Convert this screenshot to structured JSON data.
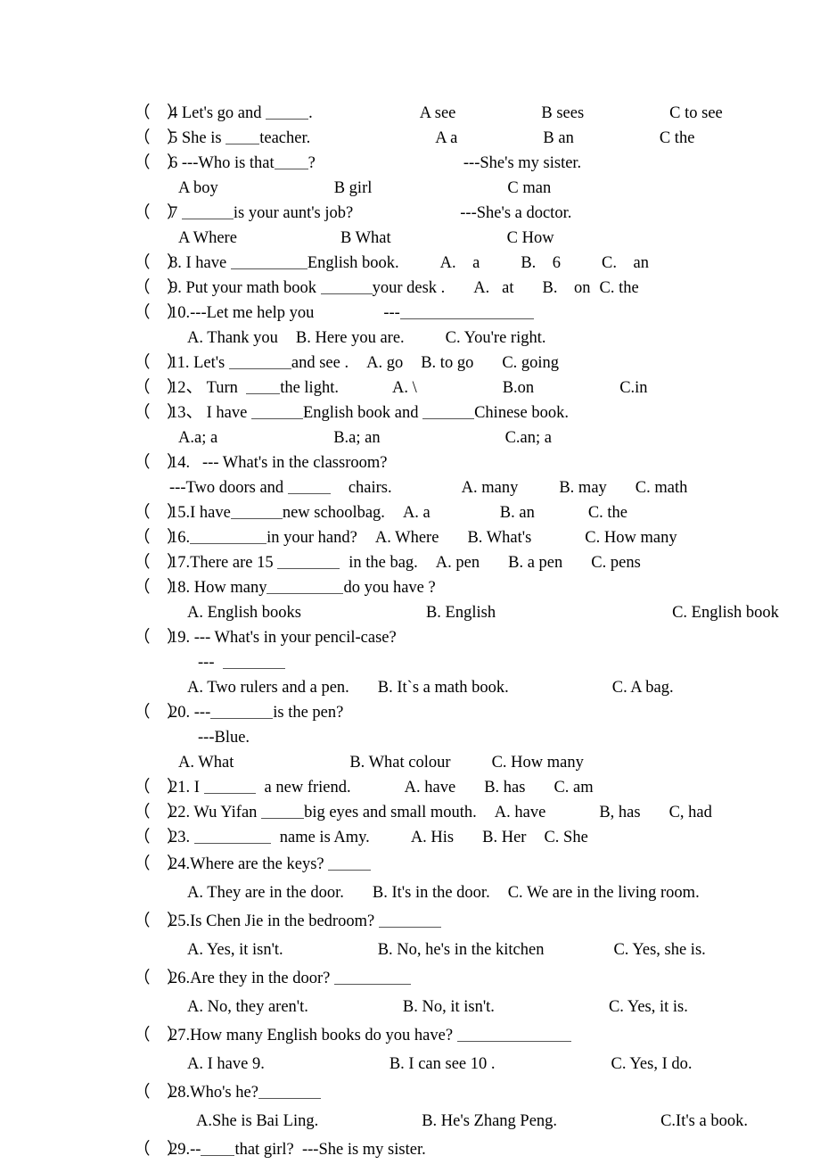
{
  "document": {
    "type": "worksheet",
    "subject": "English multiple-choice exercise",
    "marker": "（    ）"
  },
  "questions": [
    {
      "id": "q4",
      "number": "4",
      "stem_before": "4 Let's go and ",
      "stem_after": ".",
      "options_inline": [
        "A see",
        "B sees",
        "C to see"
      ]
    },
    {
      "id": "q5",
      "number": "5",
      "stem_before": "5 She is ",
      "stem_after": "teacher.",
      "options_inline": [
        "A a",
        "B an",
        "C the"
      ]
    },
    {
      "id": "q6",
      "number": "6",
      "stem_before": "6 ---Who is that",
      "stem_after": "?",
      "answer_hint": "---She's my sister.",
      "options_line": [
        "A boy",
        "B girl",
        "C man"
      ]
    },
    {
      "id": "q7",
      "number": "7",
      "stem_before": "7 ",
      "stem_after": "is your aunt's job?",
      "answer_hint": "---She's a doctor.",
      "options_line": [
        "A Where",
        "B What",
        "C How"
      ]
    },
    {
      "id": "q8",
      "number": "8",
      "stem_before": "8. I have ",
      "stem_after": "English book.",
      "options_inline": [
        "A.    a",
        "B.    6",
        "C.    an"
      ]
    },
    {
      "id": "q9",
      "number": "9",
      "stem_before": "9. Put your math book ",
      "stem_after": "your desk .",
      "options_inline": [
        "A.   at",
        "B.    on",
        "C. the"
      ]
    },
    {
      "id": "q10",
      "number": "10",
      "stem_before": "10.---Let me help you",
      "stem_after": "---",
      "options_line": [
        "A. Thank you",
        "B. Here you are.",
        "C. You're right."
      ]
    },
    {
      "id": "q11",
      "number": "11",
      "stem_before": "11. Let's ",
      "stem_after": "and see .",
      "options_inline": [
        "A. go",
        "B. to go",
        "C. going"
      ]
    },
    {
      "id": "q12",
      "number": "12",
      "stem_before": "12、 Turn  ",
      "stem_after": "the light.",
      "options_inline": [
        "A. \\",
        "B.on",
        "C.in"
      ]
    },
    {
      "id": "q13",
      "number": "13",
      "stem_before": "13、 I have ",
      "stem_mid": "English book and ",
      "stem_after": "Chinese book.",
      "options_line": [
        "A.a; a",
        "B.a; an",
        "C.an; a"
      ]
    },
    {
      "id": "q14",
      "number": "14",
      "stem_before": "14.   --- What's in the classroom?",
      "stem_second_before": "---Two doors and ",
      "stem_second_after": "chairs.",
      "options_inline": [
        "A. many",
        "B. may",
        "C. math"
      ]
    },
    {
      "id": "q15",
      "number": "15",
      "stem_before": "15.I have",
      "stem_after": "new schoolbag.",
      "options_inline": [
        "A. a",
        "B. an",
        "C. the"
      ]
    },
    {
      "id": "q16",
      "number": "16",
      "stem_before": "16.",
      "stem_after": "in your hand?",
      "options_inline": [
        "A. Where",
        "B. What's",
        "C. How many"
      ]
    },
    {
      "id": "q17",
      "number": "17",
      "stem_before": "17.There are 15 ",
      "stem_after": "in the bag.",
      "options_inline": [
        "A. pen",
        "B. a pen",
        "C. pens"
      ]
    },
    {
      "id": "q18",
      "number": "18",
      "stem_before": "18. How many",
      "stem_after": "do you have ?",
      "options_line": [
        "A. English books",
        "B. English",
        "C. English book"
      ]
    },
    {
      "id": "q19",
      "number": "19",
      "stem_before": "19. --- What's in your pencil-case?",
      "stem_second": "---",
      "options_line": [
        "A. Two rulers and a pen.",
        "B. It`s a math book.",
        "C. A bag."
      ]
    },
    {
      "id": "q20",
      "number": "20",
      "stem_before": "20. ---",
      "stem_after": "is the pen?",
      "answer_hint": "---Blue.",
      "options_line": [
        "A. What",
        "B. What colour",
        "C. How many"
      ]
    },
    {
      "id": "q21",
      "number": "21",
      "stem_before": "21. I ",
      "stem_after": "a new friend.",
      "options_inline": [
        "A. have",
        "B. has",
        "C. am"
      ]
    },
    {
      "id": "q22",
      "number": "22",
      "stem_before": "22. Wu Yifan ",
      "stem_after": "big eyes and small mouth.",
      "options_inline": [
        "A. have",
        "B, has",
        "C, had"
      ]
    },
    {
      "id": "q23",
      "number": "23",
      "stem_before": "23. ",
      "stem_after": "name is Amy.",
      "options_inline": [
        "A. His",
        "B. Her",
        "C. She"
      ]
    },
    {
      "id": "q24",
      "number": "24",
      "stem_before": "24.Where are the keys? ",
      "options_line": [
        "A. They are in the door.",
        "B. It's in the door.",
        "C. We are in the living room."
      ]
    },
    {
      "id": "q25",
      "number": "25",
      "stem_before": "25.Is Chen Jie in the bedroom? ",
      "options_line": [
        "A. Yes, it isn't.",
        "B. No, he's in the kitchen",
        "C. Yes, she is."
      ]
    },
    {
      "id": "q26",
      "number": "26",
      "stem_before": "26.Are they in the door? ",
      "options_line": [
        "A. No, they aren't.",
        "B. No, it isn't.",
        "C. Yes, it is."
      ]
    },
    {
      "id": "q27",
      "number": "27",
      "stem_before": "27.How many English books do you have? ",
      "options_line": [
        "A. I have 9.",
        "B. I can see 10 .",
        "C. Yes, I do."
      ]
    },
    {
      "id": "q28",
      "number": "28",
      "stem_before": "28.Who's he?",
      "options_line": [
        "A.She is Bai Ling.",
        "B. He's Zhang Peng.",
        "C.It's a book."
      ]
    },
    {
      "id": "q29",
      "number": "29",
      "stem_before": "29.--",
      "stem_after": "that girl?  ---She is my sister."
    }
  ]
}
